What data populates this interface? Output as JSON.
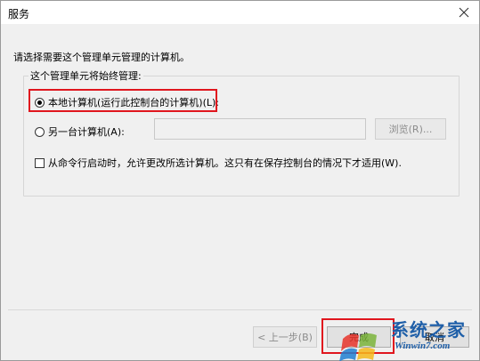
{
  "window": {
    "title": "服务"
  },
  "prompt": "请选择需要这个管理单元管理的计算机。",
  "group": {
    "legend": "这个管理单元将始终管理:",
    "local_option": "本地计算机(运行此控制台的计算机)(L):",
    "local_selected": true,
    "other_option": "另一台计算机(A):",
    "other_value": "",
    "browse_label": "浏览(R)...",
    "cmdline_option": "从命令行启动时，允许更改所选计算机。这只有在保存控制台的情况下才适用(W)."
  },
  "footer": {
    "back_label": "< 上一步(B)",
    "finish_label": "完成",
    "cancel_label": "取消"
  },
  "watermark": {
    "brand": "系统之家",
    "url": "Winwin7.com"
  },
  "colors": {
    "highlight": "#e0161e",
    "window_bg": "#f0f0f0"
  }
}
